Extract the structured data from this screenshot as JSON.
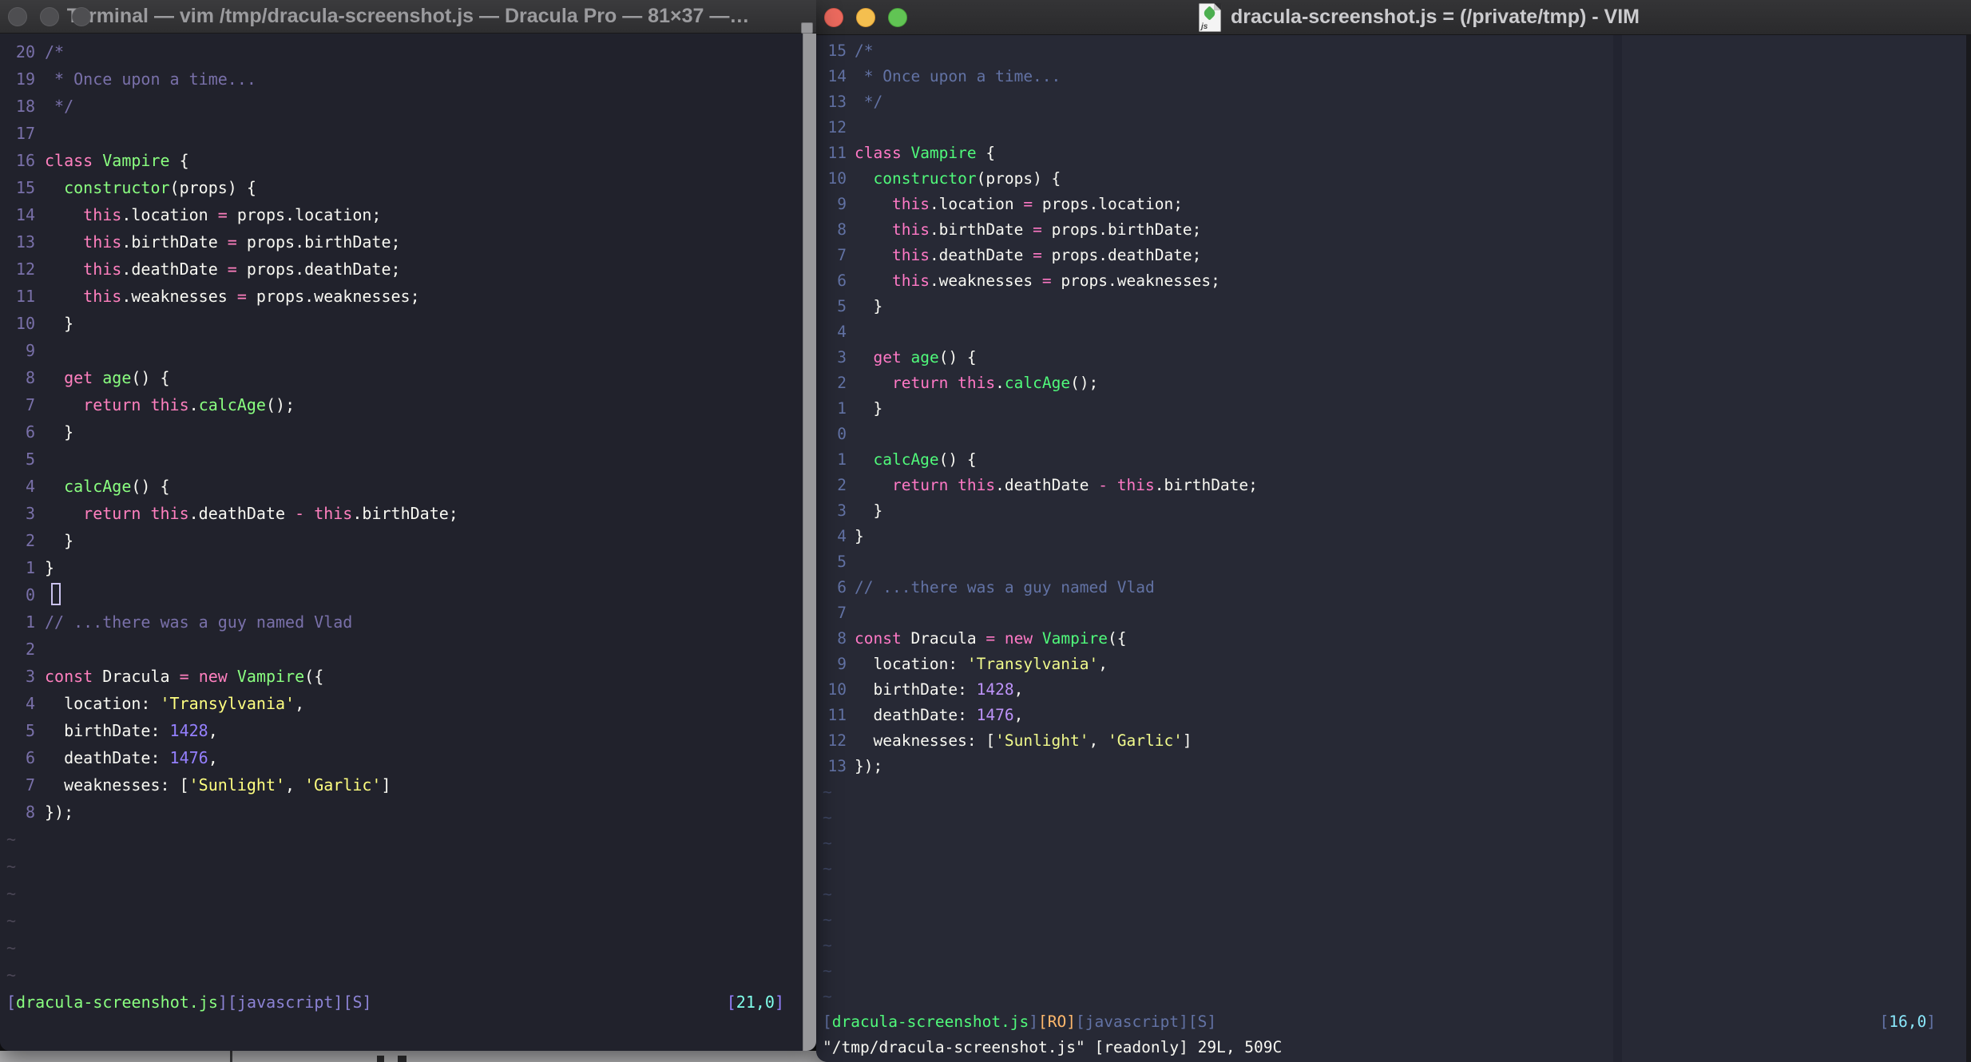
{
  "desktop": {
    "bg": "#b5b5b7"
  },
  "code_lines": [
    [
      [
        "c",
        "/*"
      ]
    ],
    [
      [
        "c",
        " * Once upon a time..."
      ]
    ],
    [
      [
        "c",
        " */"
      ]
    ],
    [],
    [
      [
        "k",
        "class"
      ],
      [
        "w",
        " "
      ],
      [
        "f",
        "Vampire"
      ],
      [
        "w",
        " {"
      ]
    ],
    [
      [
        "w",
        "  "
      ],
      [
        "f",
        "constructor"
      ],
      [
        "w",
        "(props) {"
      ]
    ],
    [
      [
        "w",
        "    "
      ],
      [
        "k",
        "this"
      ],
      [
        "w",
        ".location "
      ],
      [
        "k",
        "="
      ],
      [
        "w",
        " props.location;"
      ]
    ],
    [
      [
        "w",
        "    "
      ],
      [
        "k",
        "this"
      ],
      [
        "w",
        ".birthDate "
      ],
      [
        "k",
        "="
      ],
      [
        "w",
        " props.birthDate;"
      ]
    ],
    [
      [
        "w",
        "    "
      ],
      [
        "k",
        "this"
      ],
      [
        "w",
        ".deathDate "
      ],
      [
        "k",
        "="
      ],
      [
        "w",
        " props.deathDate;"
      ]
    ],
    [
      [
        "w",
        "    "
      ],
      [
        "k",
        "this"
      ],
      [
        "w",
        ".weaknesses "
      ],
      [
        "k",
        "="
      ],
      [
        "w",
        " props.weaknesses;"
      ]
    ],
    [
      [
        "w",
        "  }"
      ]
    ],
    [],
    [
      [
        "w",
        "  "
      ],
      [
        "k",
        "get"
      ],
      [
        "w",
        " "
      ],
      [
        "f",
        "age"
      ],
      [
        "w",
        "() {"
      ]
    ],
    [
      [
        "w",
        "    "
      ],
      [
        "k",
        "return"
      ],
      [
        "w",
        " "
      ],
      [
        "k",
        "this"
      ],
      [
        "w",
        "."
      ],
      [
        "f",
        "calcAge"
      ],
      [
        "w",
        "();"
      ]
    ],
    [
      [
        "w",
        "  }"
      ]
    ],
    [],
    [
      [
        "w",
        "  "
      ],
      [
        "f",
        "calcAge"
      ],
      [
        "w",
        "() {"
      ]
    ],
    [
      [
        "w",
        "    "
      ],
      [
        "k",
        "return"
      ],
      [
        "w",
        " "
      ],
      [
        "k",
        "this"
      ],
      [
        "w",
        ".deathDate "
      ],
      [
        "k",
        "-"
      ],
      [
        "w",
        " "
      ],
      [
        "k",
        "this"
      ],
      [
        "w",
        ".birthDate;"
      ]
    ],
    [
      [
        "w",
        "  }"
      ]
    ],
    [
      [
        "w",
        "}"
      ]
    ],
    [],
    [
      [
        "c",
        "// ...there was a guy named Vlad"
      ]
    ],
    [],
    [
      [
        "k",
        "const"
      ],
      [
        "w",
        " Dracula "
      ],
      [
        "k",
        "="
      ],
      [
        "w",
        " "
      ],
      [
        "k",
        "new"
      ],
      [
        "w",
        " "
      ],
      [
        "f",
        "Vampire"
      ],
      [
        "w",
        "({"
      ]
    ],
    [
      [
        "w",
        "  location: "
      ],
      [
        "s",
        "'Transylvania'"
      ],
      [
        "w",
        ","
      ]
    ],
    [
      [
        "w",
        "  birthDate: "
      ],
      [
        "n",
        "1428"
      ],
      [
        "w",
        ","
      ]
    ],
    [
      [
        "w",
        "  deathDate: "
      ],
      [
        "n",
        "1476"
      ],
      [
        "w",
        ","
      ]
    ],
    [
      [
        "w",
        "  weaknesses: ["
      ],
      [
        "s",
        "'Sunlight'"
      ],
      [
        "w",
        ", "
      ],
      [
        "s",
        "'Garlic'"
      ],
      [
        "w",
        "]"
      ]
    ],
    [
      [
        "w",
        "});"
      ]
    ]
  ],
  "left_window": {
    "title": "Terminal — vim /tmp/dracula-screenshot.js — Dracula Pro — 81×37 —…",
    "theme_name": "Dracula Pro",
    "window_buttons": [
      "close",
      "minimize",
      "zoom"
    ],
    "rel_numbers": [
      "20",
      "19",
      "18",
      "17",
      "16",
      "15",
      "14",
      "13",
      "12",
      "11",
      "10",
      "9",
      "8",
      "7",
      "6",
      "5",
      "4",
      "3",
      "2",
      "1",
      "0",
      "1",
      "2",
      "3",
      "4",
      "5",
      "6",
      "7",
      "8"
    ],
    "cursor_row": 20,
    "tilde_count": 6,
    "status_segments": [
      [
        "sb",
        "["
      ],
      [
        "sf",
        "dracula-screenshot.js"
      ],
      [
        "sb",
        "][javascript][S]"
      ]
    ],
    "ruler_segments": [
      [
        "rb",
        "["
      ],
      [
        "rv",
        "21,0"
      ],
      [
        "rb",
        "]"
      ]
    ],
    "cmd_segments": [],
    "colors": {
      "bg": "#21222c",
      "w": "#f8f8f2",
      "c": "#7970a9",
      "num": "#7970a9",
      "k": "#ff80bf",
      "f": "#8aff80",
      "s": "#ffff80",
      "n": "#9580ff",
      "tilde": "#4b4756",
      "sb": "#8c83d4",
      "sf": "#8aff80",
      "ro": "#ffca80",
      "rb": "#9580ff",
      "rv": "#80ffea",
      "cursor": "#cbc3ee"
    }
  },
  "right_window": {
    "title": "dracula-screenshot.js = (/private/tmp) - VIM",
    "file_icon": "js-document-icon",
    "icon_label": "js",
    "window_buttons": [
      "close",
      "minimize",
      "zoom"
    ],
    "rel_numbers": [
      "15",
      "14",
      "13",
      "12",
      "11",
      "10",
      "9",
      "8",
      "7",
      "6",
      "5",
      "4",
      "3",
      "2",
      "1",
      "0",
      "1",
      "2",
      "3",
      "4",
      "5",
      "6",
      "7",
      "8",
      "9",
      "10",
      "11",
      "12",
      "13"
    ],
    "cursor_row": null,
    "tilde_count": 9,
    "status_segments": [
      [
        "sb",
        "["
      ],
      [
        "sf",
        "dracula-screenshot.js"
      ],
      [
        "sb",
        "]"
      ],
      [
        "ro",
        "[RO]"
      ],
      [
        "sb",
        "[javascript][S]"
      ]
    ],
    "ruler_segments": [
      [
        "rb",
        "["
      ],
      [
        "rv",
        "16,0"
      ],
      [
        "rb",
        "]"
      ]
    ],
    "cmd_segments": [
      [
        "w",
        "\"/tmp/dracula-screenshot.js\" [readonly] 29L, 509C"
      ]
    ],
    "colors": {
      "bg": "#272935",
      "w": "#f8f8f2",
      "c": "#6272a4",
      "num": "#6272a4",
      "k": "#ff79c6",
      "f": "#50fa7b",
      "s": "#f1fa8c",
      "n": "#bd93f9",
      "tilde": "#3e4663",
      "sb": "#6272a4",
      "sf": "#50fa7b",
      "ro": "#ffb86c",
      "rb": "#6272a4",
      "rv": "#8be9fd",
      "cursor": "#cbc3ee"
    }
  }
}
